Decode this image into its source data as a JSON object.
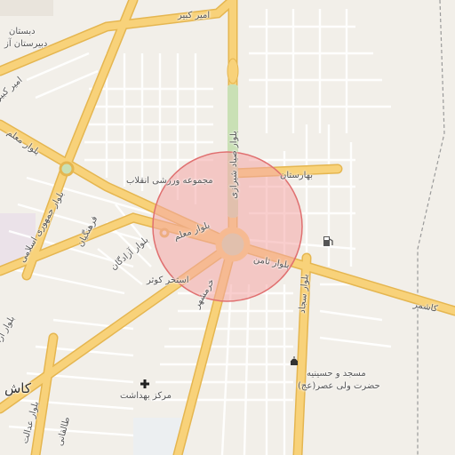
{
  "map": {
    "labels": {
      "amir_kabir_top": "امیر کبیر",
      "school_1": "دبستان",
      "school_2": "دبیرستان آز",
      "amir_kabir_left": "امیر کبیر",
      "blvd_moallem_left": "بلوار معلم",
      "jomhouri": "بلوار جمهوری اسلامی",
      "farhangian": "فرهنگیان",
      "azadegan": "بلوار آزادگان",
      "sports_complex": "مجموعه ورزشی انقلاب",
      "blvd_moallem_center": "بلوار معلم",
      "sayyad_shirazi": "بلوار صیاد شیرازی",
      "baharestan": "بهارستان",
      "blvd_samen": "بلوار ثامن",
      "pool_kowsar": "استخر کوثر",
      "khorramshahr": "خرمشهر",
      "blvd_sajjad": "بلوار سجاد",
      "kashmar": "کاشمر",
      "mosque": "مسجد و حسینیه",
      "mosque_2": "حضرت ولی عصر(عج)",
      "health_center": "مرکز بهداشت",
      "kashan_city": "کاش",
      "blvd_azad_left": "بلوار آزا",
      "blvd_edalat": "بلوار عدالت",
      "taleghani": "طالقانی"
    },
    "icons": {
      "fuel": "fuel-station-icon",
      "mosque": "mosque-icon",
      "hospital": "hospital-cross-icon"
    },
    "colors": {
      "background": "#f2efe9",
      "major_road": "#f8d27a",
      "major_road_casing": "#e5b650",
      "minor_road": "#ffffff",
      "highlight_fill": "#f4a6a6",
      "highlight_stroke": "#e07070",
      "park": "#c9e0b5",
      "railway": "#9a9a9a"
    },
    "highlight_radius_m": "~500"
  }
}
